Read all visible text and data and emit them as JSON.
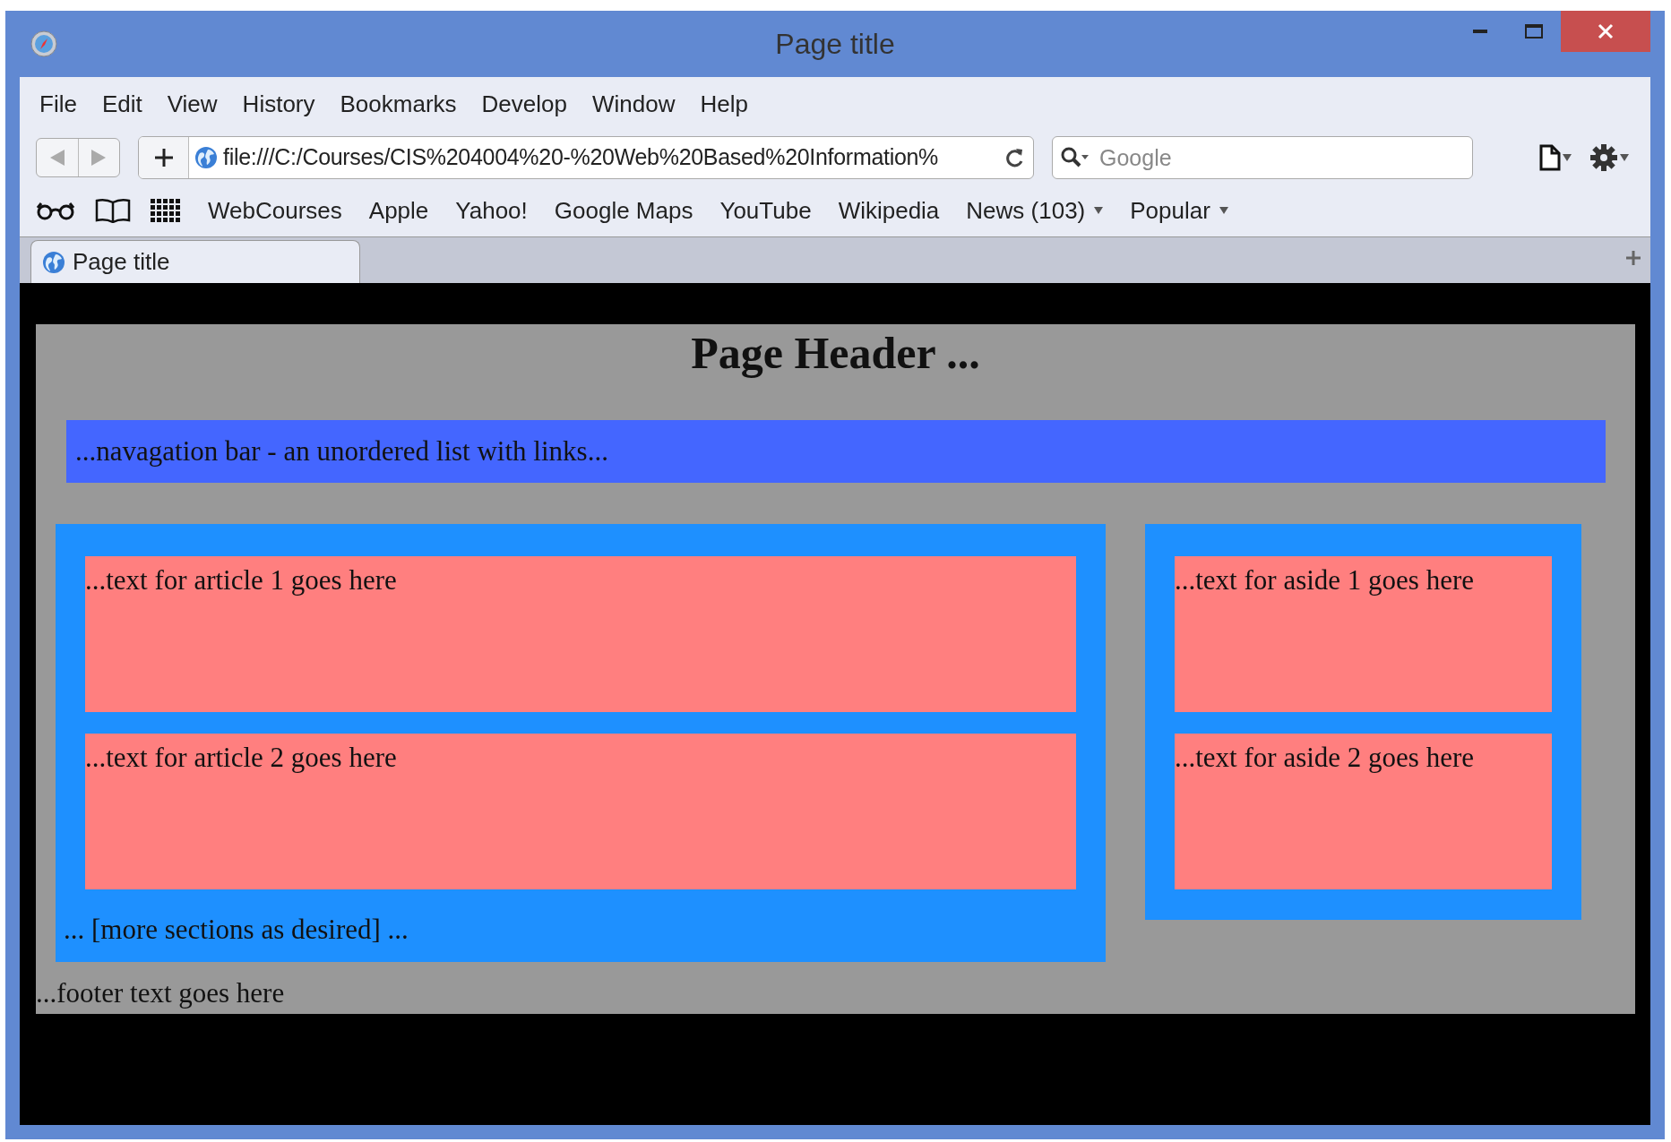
{
  "window": {
    "title": "Page title"
  },
  "menu": [
    "File",
    "Edit",
    "View",
    "History",
    "Bookmarks",
    "Develop",
    "Window",
    "Help"
  ],
  "address": {
    "value": "file:///C:/Courses/CIS%204004%20-%20Web%20Based%20Information%"
  },
  "search": {
    "placeholder": "Google"
  },
  "bookmarks": [
    {
      "label": "WebCourses",
      "has_menu": false
    },
    {
      "label": "Apple",
      "has_menu": false
    },
    {
      "label": "Yahoo!",
      "has_menu": false
    },
    {
      "label": "Google Maps",
      "has_menu": false
    },
    {
      "label": "YouTube",
      "has_menu": false
    },
    {
      "label": "Wikipedia",
      "has_menu": false
    },
    {
      "label": "News (103)",
      "has_menu": true
    },
    {
      "label": "Popular",
      "has_menu": true
    }
  ],
  "tabs": [
    {
      "label": "Page title",
      "selected": true
    }
  ],
  "page": {
    "header": "Page Header ...",
    "nav": "...navagation bar - an unordered list with links...",
    "articles": [
      "...text for article 1 goes here",
      "...text for article 2 goes here"
    ],
    "more": "... [more sections as desired] ...",
    "asides": [
      "...text for aside 1 goes here",
      "...text for aside 2 goes here"
    ],
    "footer": "...footer text goes here"
  }
}
